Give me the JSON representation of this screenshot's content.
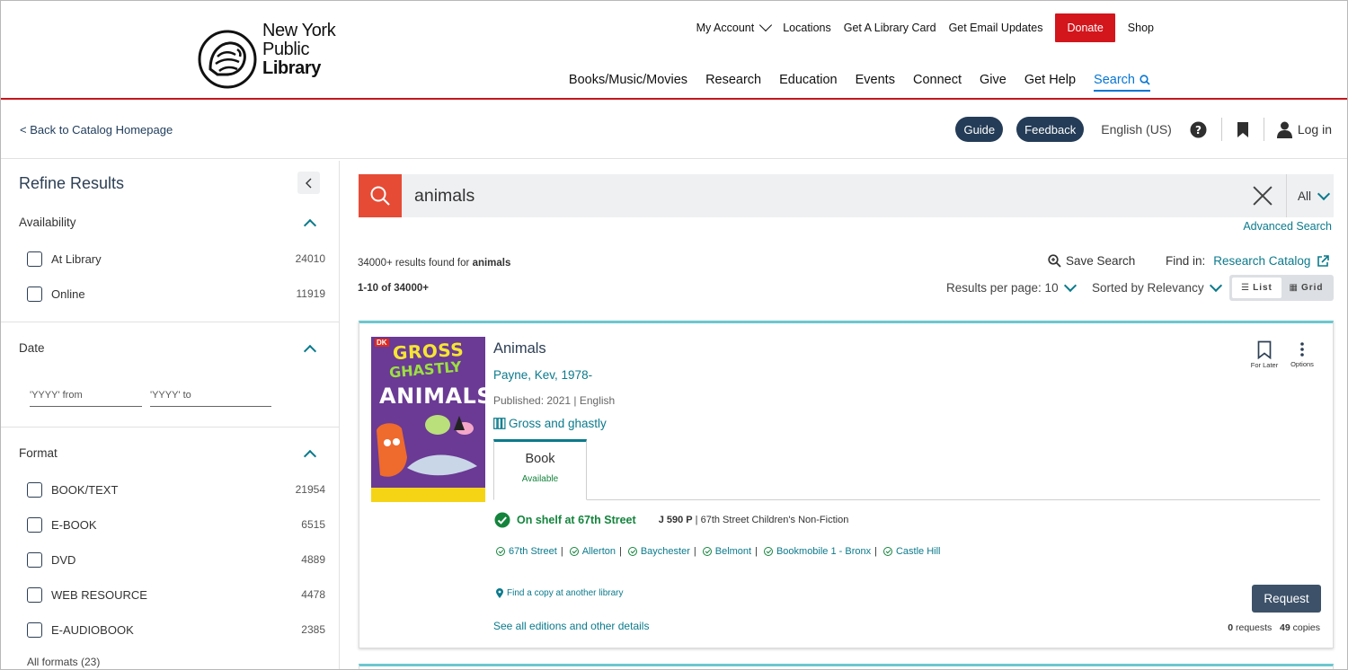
{
  "header": {
    "logo_lines": [
      "New York",
      "Public",
      "Library"
    ],
    "utility_nav": [
      "My Account",
      "Locations",
      "Get A Library Card",
      "Get Email Updates"
    ],
    "donate_label": "Donate",
    "shop_label": "Shop",
    "main_nav": [
      "Books/Music/Movies",
      "Research",
      "Education",
      "Events",
      "Connect",
      "Give",
      "Get Help"
    ],
    "search_label": "Search",
    "accent_color": "#c4161c"
  },
  "subbar": {
    "back_link": "< Back to Catalog Homepage",
    "guide_label": "Guide",
    "feedback_label": "Feedback",
    "language": "English (US)",
    "login_label": "Log in"
  },
  "sidebar": {
    "title": "Refine Results",
    "availability": {
      "heading": "Availability",
      "items": [
        {
          "label": "At Library",
          "count": "24010"
        },
        {
          "label": "Online",
          "count": "11919"
        }
      ]
    },
    "date": {
      "heading": "Date",
      "from_placeholder": "'YYYY' from",
      "to_placeholder": "'YYYY' to"
    },
    "format": {
      "heading": "Format",
      "items": [
        {
          "label": "BOOK/TEXT",
          "count": "21954"
        },
        {
          "label": "E-BOOK",
          "count": "6515"
        },
        {
          "label": "DVD",
          "count": "4889"
        },
        {
          "label": "WEB RESOURCE",
          "count": "4478"
        },
        {
          "label": "E-AUDIOBOOK",
          "count": "2385"
        }
      ],
      "all_formats": "All formats (23)"
    }
  },
  "search": {
    "query": "animals",
    "scope": "All",
    "advanced_label": "Advanced Search",
    "results_found_prefix": "34000+ results found for",
    "results_found_term": "animals",
    "range": "1-10 of 34000+",
    "save_search_label": "Save Search",
    "find_in_label": "Find in:",
    "research_catalog_label": "Research Catalog",
    "results_per_page": "Results per page: 10",
    "sorted_by": "Sorted by Relevancy",
    "view_list": "List",
    "view_grid": "Grid"
  },
  "result": {
    "cover_text": {
      "dk": "DK",
      "line1": "GROSS",
      "line2": "GHASTLY",
      "line3": "ANIMALS"
    },
    "title": "Animals",
    "author": "Payne, Kev, 1978-",
    "published": "Published: 2021 | English",
    "series": "Gross and ghastly",
    "for_later_label": "For Later",
    "options_label": "Options",
    "format_tab": "Book",
    "format_status": "Available",
    "on_shelf": "On shelf at 67th Street",
    "call_number": "J 590 P",
    "call_location": "| 67th Street Children's Non-Fiction",
    "branches": [
      "67th Street",
      "Allerton",
      "Baychester",
      "Belmont",
      "Bookmobile 1 - Bronx",
      "Castle Hill"
    ],
    "find_copy": "Find a copy at another library",
    "see_all": "See all editions and other details",
    "request_label": "Request",
    "requests_count": "0",
    "requests_label": "requests",
    "copies_count": "49",
    "copies_label": "copies"
  }
}
